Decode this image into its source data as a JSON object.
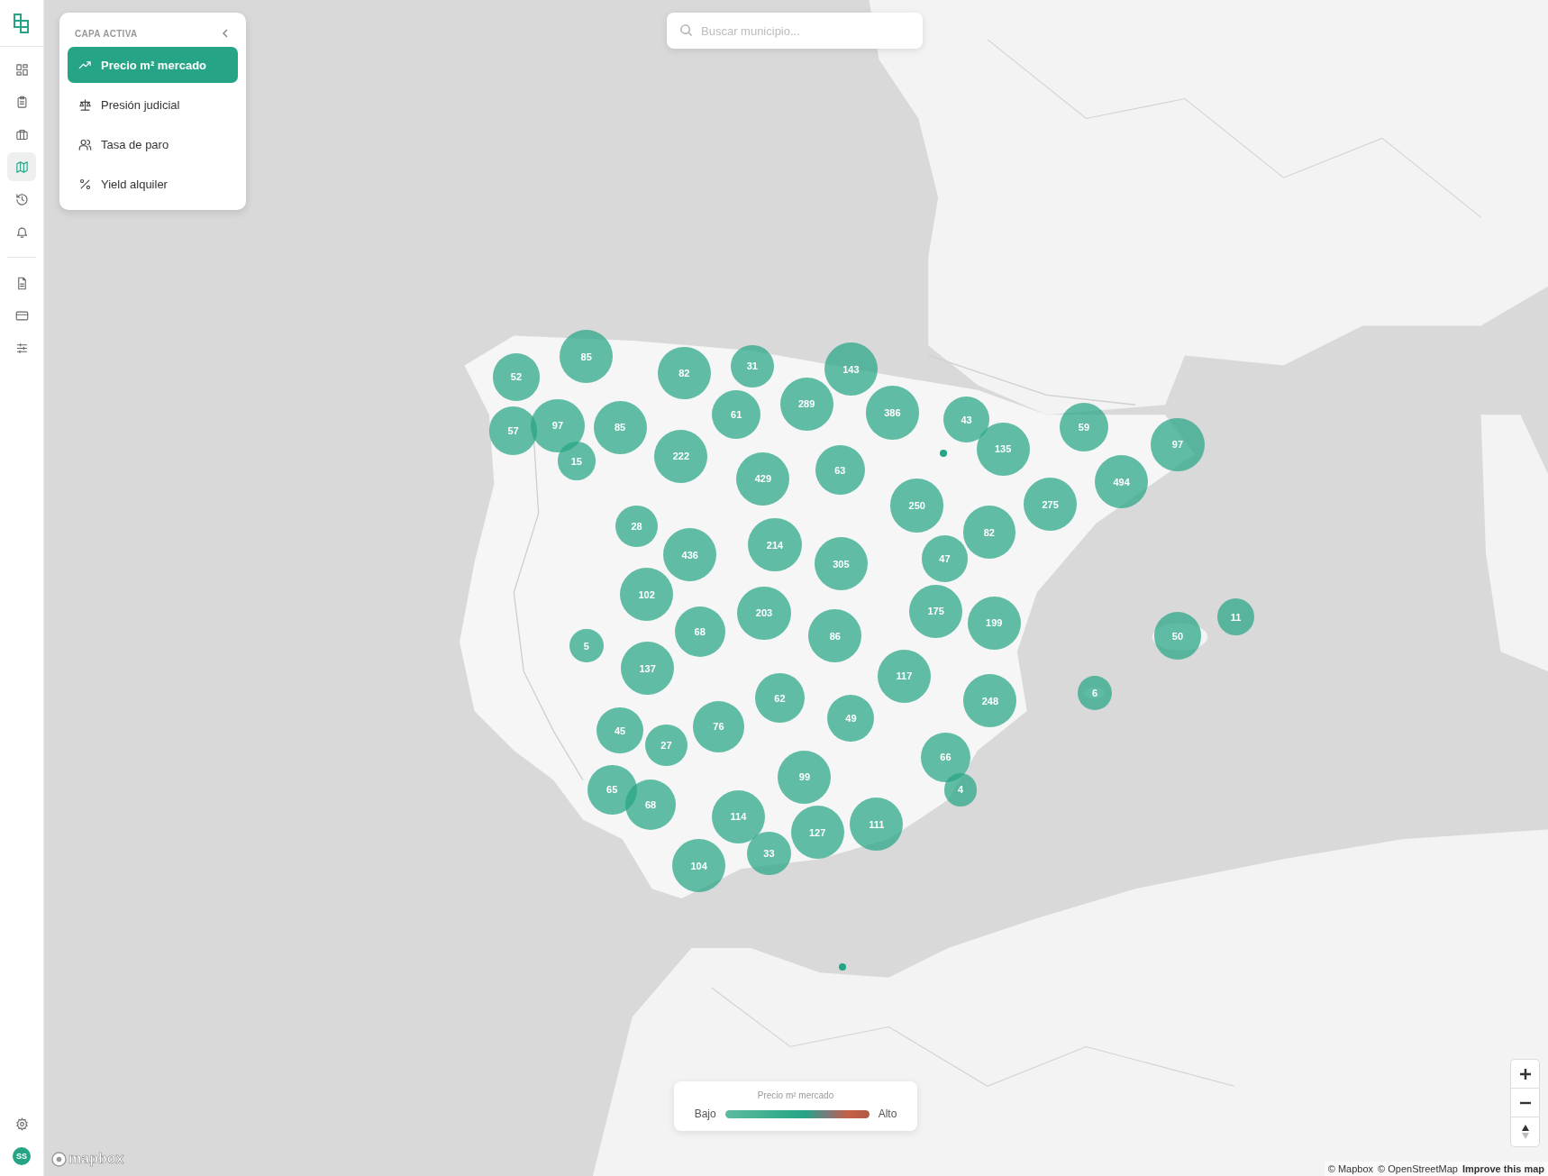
{
  "sidebar": {
    "nav": [
      {
        "selected": false
      },
      {
        "selected": false
      },
      {
        "selected": false
      },
      {
        "selected": true
      },
      {
        "selected": false
      },
      {
        "selected": false
      }
    ],
    "nav_secondary": [
      {
        "selected": false
      },
      {
        "selected": false
      },
      {
        "selected": false
      }
    ],
    "user": {
      "initials": "SS"
    }
  },
  "layer_panel": {
    "title": "CAPA ACTIVA",
    "items": [
      {
        "label": "Precio m² mercado",
        "selected": true
      },
      {
        "label": "Presión judicial",
        "selected": false
      },
      {
        "label": "Tasa de paro",
        "selected": false
      },
      {
        "label": "Yield alquiler",
        "selected": false
      }
    ]
  },
  "search": {
    "placeholder": "Buscar municipio..."
  },
  "map": {
    "clusters": [
      "52",
      "85",
      "82",
      "31",
      "143",
      "57",
      "97",
      "85",
      "15",
      "61",
      "289",
      "386",
      "43",
      "222",
      "429",
      "63",
      "135",
      "59",
      "97",
      "494",
      "275",
      "250",
      "82",
      "28",
      "436",
      "214",
      "305",
      "47",
      "102",
      "68",
      "203",
      "86",
      "175",
      "199",
      "5",
      "137",
      "117",
      "62",
      "248",
      "50",
      "11",
      "6",
      "45",
      "76",
      "49",
      "27",
      "66",
      "4",
      "99",
      "65",
      "68",
      "114",
      "127",
      "111",
      "33",
      "104"
    ]
  },
  "legend": {
    "title": "Precio m² mercado",
    "low": "Bajo",
    "high": "Alto"
  },
  "attribution": {
    "logo": "mapbox",
    "links": [
      "© Mapbox",
      "© OpenStreetMap",
      "Improve this map"
    ]
  }
}
